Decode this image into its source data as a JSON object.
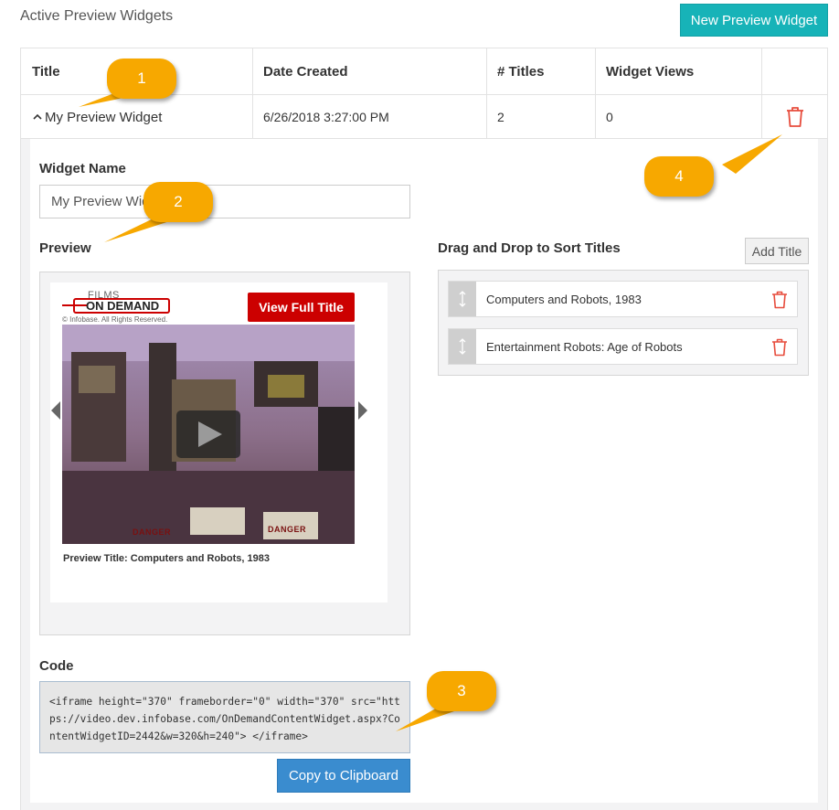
{
  "header": {
    "title": "Active Preview Widgets",
    "new_button": "New Preview Widget"
  },
  "table": {
    "columns": [
      "Title",
      "Date Created",
      "# Titles",
      "Widget Views"
    ],
    "row": {
      "chevron": "^",
      "title": "My Preview Widget",
      "date": "6/26/2018 3:27:00 PM",
      "titles": "2",
      "views": "0",
      "delete_icon": "trash-icon"
    }
  },
  "editor": {
    "widget_name_label": "Widget Name",
    "widget_name_value": "My Preview Widget",
    "preview_label": "Preview",
    "sort_label": "Drag and Drop to Sort Titles",
    "add_title_button": "Add Title",
    "sort_items": [
      {
        "label": "Computers and Robots, 1983"
      },
      {
        "label": "Entertainment Robots: Age of Robots"
      }
    ],
    "code_label": "Code",
    "code_value": "<iframe height=\"370\" frameborder=\"0\" width=\"370\" src=\"https://video.dev.infobase.com/OnDemandContentWidget.aspx?ContentWidgetID=2442&w=320&h=240\"> </iframe>",
    "copy_button": "Copy to Clipboard"
  },
  "preview_widget": {
    "logo_line1": "FILMS",
    "logo_line2": "ON DEMAND",
    "copyright": "© Infobase. All Rights Reserved.",
    "view_full_button": "View Full Title",
    "preview_caption": "Preview Title: Computers and Robots, 1983",
    "danger_sign": "DANGER"
  },
  "callouts": [
    "1",
    "2",
    "3",
    "4"
  ],
  "colors": {
    "accent_teal": "#17b3b8",
    "copy_blue": "#3a8ccf",
    "delete_red": "#e74c3c",
    "callout_orange": "#f7a800",
    "view_full_red": "#cc0000"
  }
}
